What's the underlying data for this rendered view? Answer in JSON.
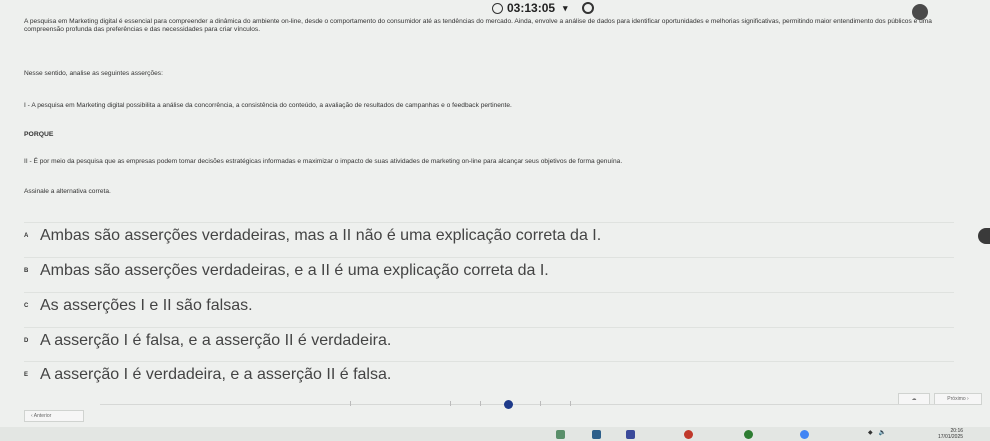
{
  "timer": {
    "value": "03:13:05"
  },
  "question": {
    "intro": "A pesquisa em Marketing digital é essencial para compreender a dinâmica do ambiente on-line, desde o comportamento do consumidor até as tendências do mercado. Ainda, envolve a análise de dados para identificar oportunidades e melhorias significativas, permitindo maior entendimento dos públicos e uma compreensão profunda das preferências e das necessidades para criar vínculos.",
    "lead": "Nesse sentido, analise as seguintes asserções:",
    "assertion_1": "I - A pesquisa em Marketing digital possibilita a análise da concorrência, a consistência do conteúdo, a avaliação de resultados de campanhas e o feedback pertinente.",
    "connector": "PORQUE",
    "assertion_2": "II - É por meio da pesquisa que as empresas podem tomar decisões estratégicas informadas e maximizar o impacto de suas atividades de marketing on-line para alcançar seus objetivos de forma genuína.",
    "instruction": "Assinale a alternativa correta."
  },
  "options": [
    {
      "letter": "A",
      "text": "Ambas são asserções verdadeiras, mas a II não é uma explicação correta da I."
    },
    {
      "letter": "B",
      "text": "Ambas são asserções verdadeiras, e a II é uma explicação correta da I."
    },
    {
      "letter": "C",
      "text": "As asserções I e II são falsas."
    },
    {
      "letter": "D",
      "text": "A asserção I é falsa, e a asserção II é verdadeira."
    },
    {
      "letter": "E",
      "text": "A asserção I é verdadeira, e a asserção II é falsa."
    }
  ],
  "nav": {
    "prev_label": "‹ Anterior",
    "next_label": "Próximo ›",
    "progress_fraction": 0.47
  },
  "taskbar": {
    "time": "20:16",
    "date": "17/01/2025"
  }
}
